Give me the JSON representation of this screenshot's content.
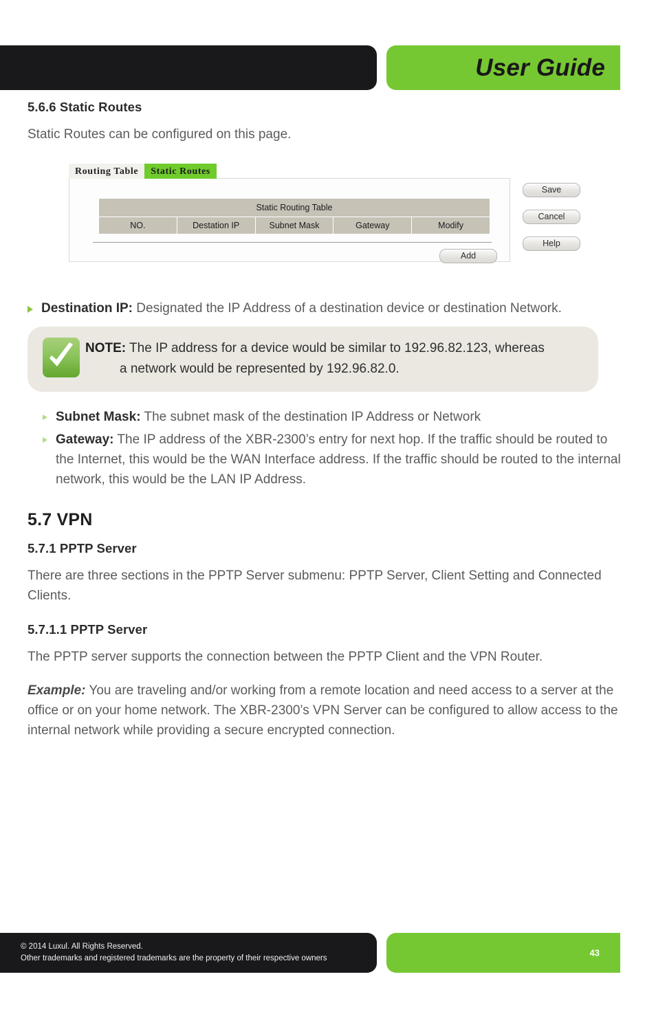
{
  "header": {
    "title": "User Guide"
  },
  "sections": {
    "static_routes": {
      "heading": "5.6.6 Static Routes",
      "intro": "Static Routes can be configured on this page."
    },
    "vpn": {
      "heading": "5.7 VPN",
      "pptp_heading": "5.7.1 PPTP Server",
      "pptp_intro": "There are three sections in the PPTP Server submenu: PPTP Server, Client Setting and Connected Clients.",
      "pptp_sub_heading": "5.7.1.1 PPTP Server",
      "pptp_sub_intro": "The PPTP server supports the connection between the PPTP Client and the VPN Router.",
      "example_label": "Example:",
      "example_text": " You are traveling and/or working from a remote location and need access to a server at the office or on your home network. The XBR-2300’s VPN Server can be configured to allow access to the internal network while providing a secure encrypted connection."
    }
  },
  "ui_screenshot": {
    "tabs": [
      {
        "label": "Routing Table",
        "active": false
      },
      {
        "label": "Static Routes",
        "active": true
      }
    ],
    "table": {
      "title": "Static Routing Table",
      "columns": [
        "NO.",
        "Destation IP",
        "Subnet Mask",
        "Gateway",
        "Modify"
      ],
      "rows": []
    },
    "add_button": "Add",
    "side_buttons": [
      "Save",
      "Cancel",
      "Help"
    ]
  },
  "definitions": [
    {
      "term": "Destination IP:",
      "desc": " Designated the IP Address of a destination device or destination Network.",
      "level": 1
    },
    {
      "term": "Subnet Mask:",
      "desc": " The subnet mask of the destination IP Address or Network",
      "level": 2
    },
    {
      "term": "Gateway:",
      "desc": " The IP address of the XBR-2300’s entry for next hop. If the traffic should be routed to the Internet, this would be the WAN Interface address. If the traffic should be routed to the internal network, this would be the LAN IP Address.",
      "level": 2
    }
  ],
  "note": {
    "label": "NOTE:",
    "line1": " The IP address for a device would be similar to 192.96.82.123, whereas",
    "line2": "a network would be represented by 192.96.82.0.",
    "icon": "green-check-badge"
  },
  "footer": {
    "copyright": "© 2014  Luxul. All Rights Reserved.",
    "trademark": "Other trademarks and registered trademarks are the property of their respective owners",
    "page_number": "43"
  },
  "colors": {
    "brand_green": "#76c832",
    "header_black": "#19181a",
    "note_bg": "#ebe8e1",
    "table_header": "#c6c2b6"
  }
}
